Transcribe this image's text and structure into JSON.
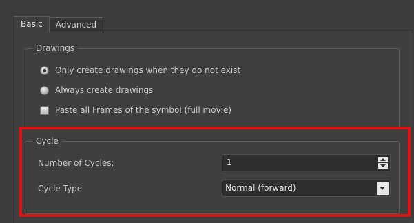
{
  "tabs": [
    {
      "label": "Basic",
      "active": true
    },
    {
      "label": "Advanced",
      "active": false
    }
  ],
  "drawings": {
    "title": "Drawings",
    "options": [
      {
        "label": "Only create drawings when they do not exist",
        "selected": true
      },
      {
        "label": "Always create drawings",
        "selected": false
      }
    ],
    "paste_all_frames": {
      "label": "Paste all Frames of the symbol (full movie)",
      "checked": false
    }
  },
  "cycle": {
    "title": "Cycle",
    "number_label": "Number of Cycles:",
    "number_value": "1",
    "type_label": "Cycle Type",
    "type_value": "Normal (forward)"
  },
  "colors": {
    "background": "#3c3c3c",
    "highlight": "#e01010"
  }
}
